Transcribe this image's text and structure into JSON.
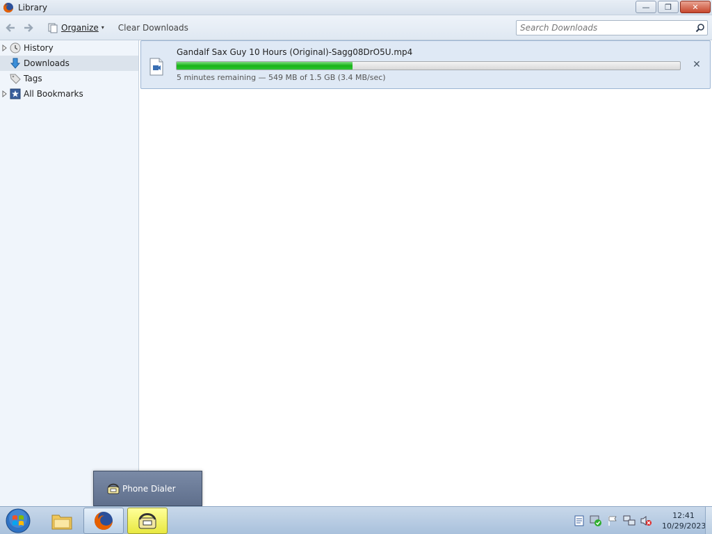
{
  "window": {
    "title": "Library",
    "minimize_glyph": "—",
    "restore_glyph": "❐",
    "close_glyph": "✕"
  },
  "toolbar": {
    "back_glyph": "🡐",
    "forward_glyph": "🡒",
    "organize_label": "Organize",
    "organize_caret": "▾",
    "clear_downloads_label": "Clear Downloads",
    "search_placeholder": "Search Downloads"
  },
  "sidebar": {
    "items": [
      {
        "label": "History",
        "icon": "clock-icon",
        "expandable": true,
        "selected": false
      },
      {
        "label": "Downloads",
        "icon": "download-arrow-icon",
        "expandable": false,
        "selected": true
      },
      {
        "label": "Tags",
        "icon": "tag-icon",
        "expandable": false,
        "selected": false
      },
      {
        "label": "All Bookmarks",
        "icon": "star-icon",
        "expandable": true,
        "selected": false
      }
    ]
  },
  "downloads": [
    {
      "filename": "Gandalf Sax Guy 10 Hours (Original)-Sagg08DrO5U.mp4",
      "progress_fraction": 0.35,
      "status": "5 minutes remaining — 549 MB of 1.5 GB (3.4 MB/sec)",
      "cancel_glyph": "✕"
    }
  ],
  "jump_popup": {
    "label": "Phone Dialer"
  },
  "taskbar": {
    "clock_time": "12:41",
    "clock_date": "10/29/2023"
  },
  "colors": {
    "progress_fill": "#17b317",
    "selection": "#dbe3ec",
    "download_row": "#dfe9f5"
  }
}
